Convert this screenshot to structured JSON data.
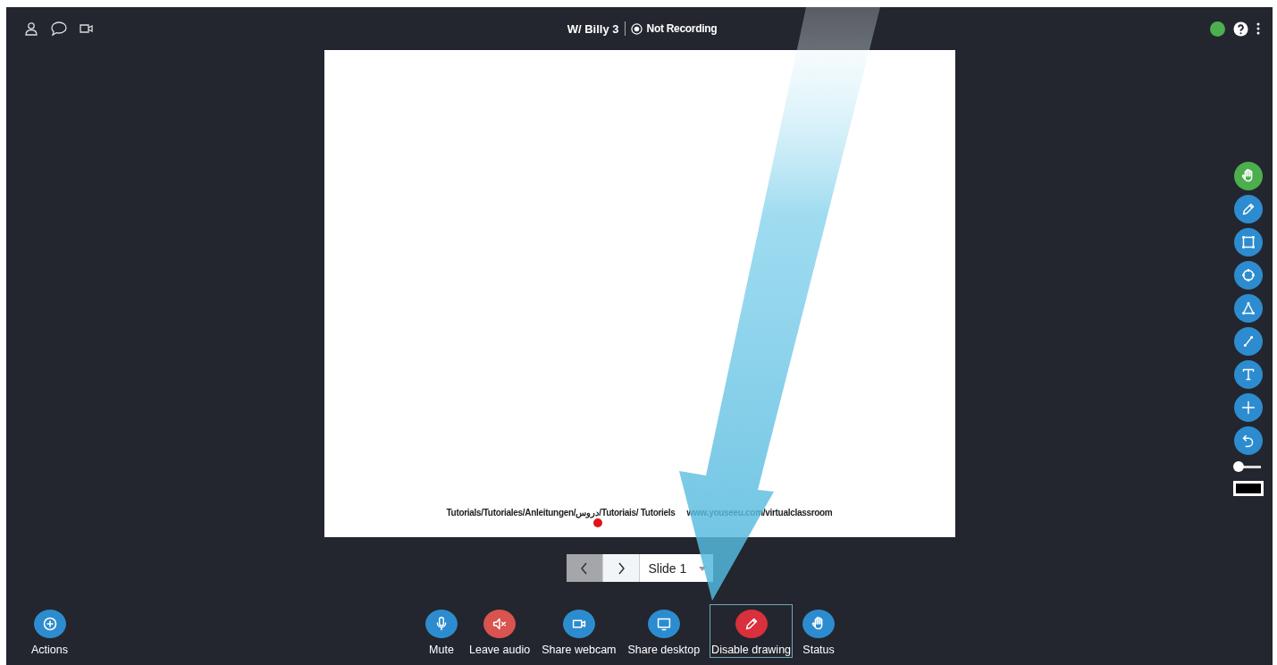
{
  "header": {
    "title": "W/ Billy 3",
    "recording": {
      "label": "Not Recording",
      "on": false
    },
    "connection": {
      "color": "#4caf50"
    }
  },
  "slide": {
    "lines": [
      "Tutorials/Tutoriales/Anleitungen/دروس/Tutoriais/ Tutoriels",
      "www.youseeu.com/virtualclassroom"
    ]
  },
  "slide_nav": {
    "previous": {
      "disabled": true
    },
    "next": {
      "disabled": false
    },
    "current": "Slide 1"
  },
  "drawing_tools": [
    {
      "kind": "hand",
      "selected": true
    },
    {
      "kind": "pencil",
      "selected": false
    },
    {
      "kind": "rectangle",
      "selected": false
    },
    {
      "kind": "ellipse",
      "selected": false
    },
    {
      "kind": "triangle",
      "selected": false
    },
    {
      "kind": "line",
      "selected": false
    },
    {
      "kind": "text",
      "selected": false
    },
    {
      "kind": "plus",
      "selected": false
    },
    {
      "kind": "undo",
      "selected": false
    }
  ],
  "thickness": {
    "level": 0.1
  },
  "color_swatch": {
    "color": "#000000"
  },
  "actions": {
    "label": "Actions"
  },
  "controls": [
    {
      "label": "Mute",
      "kind": "mic",
      "color": "#2d8ccf",
      "selected": false
    },
    {
      "label": "Leave audio",
      "kind": "speaker",
      "color": "#d9534f",
      "selected": false
    },
    {
      "label": "Share webcam",
      "kind": "camera",
      "color": "#2d8ccf",
      "selected": false
    },
    {
      "label": "Share desktop",
      "kind": "monitor",
      "color": "#2d8ccf",
      "selected": false
    },
    {
      "label": "Disable drawing",
      "kind": "pencil",
      "color": "#d8303c",
      "selected": true
    },
    {
      "label": "Status",
      "kind": "hand",
      "color": "#2d8ccf",
      "selected": false
    }
  ]
}
